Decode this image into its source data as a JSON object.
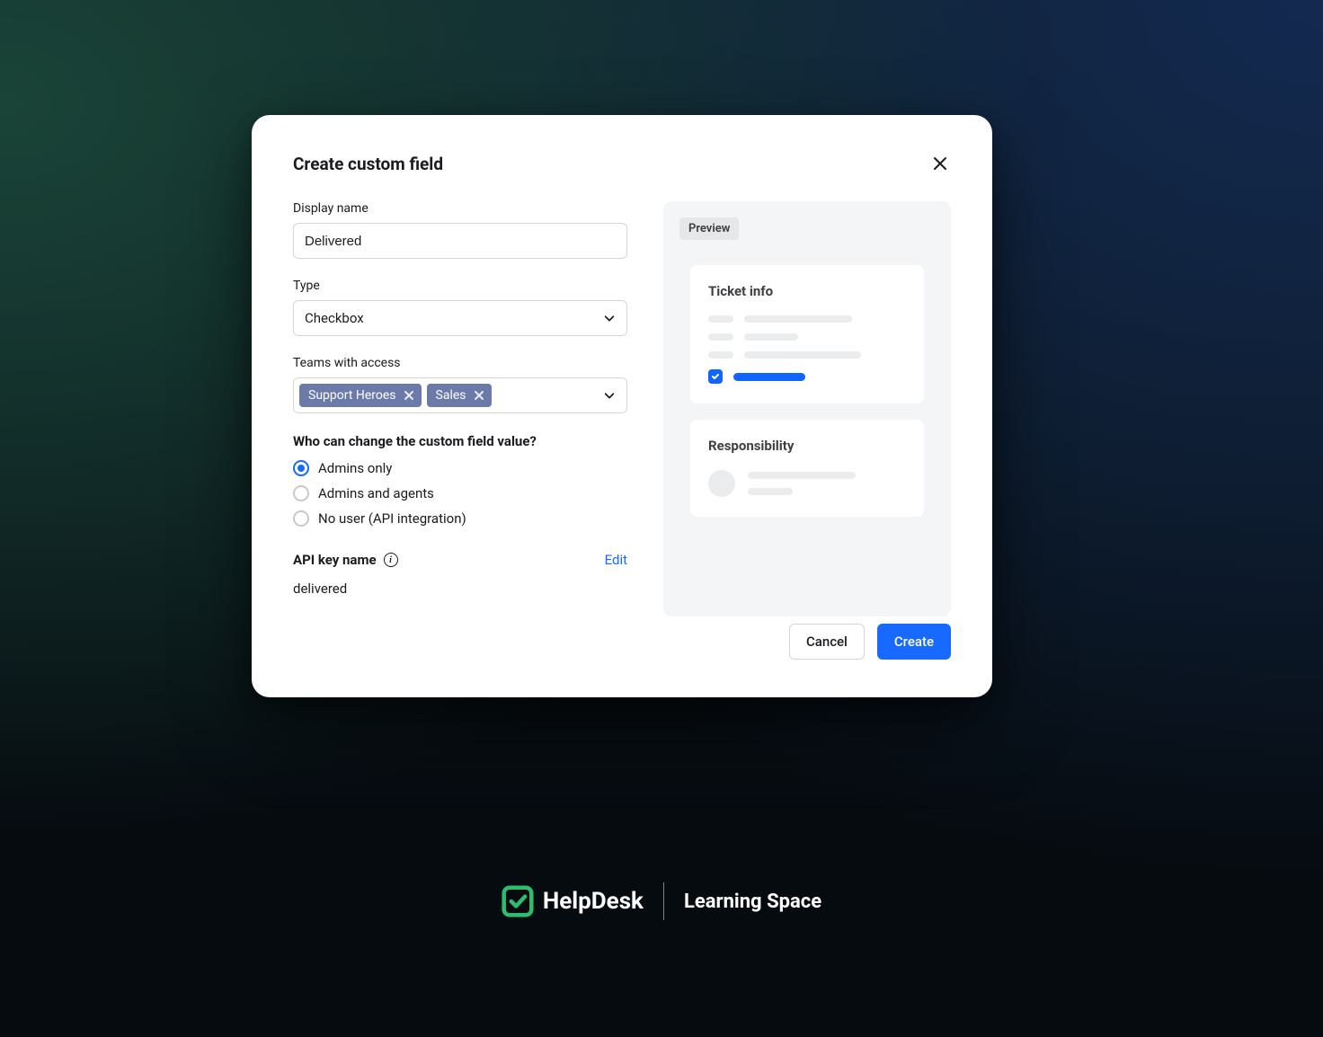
{
  "modal": {
    "title": "Create custom field",
    "display_name": {
      "label": "Display name",
      "value": "Delivered"
    },
    "type": {
      "label": "Type",
      "value": "Checkbox"
    },
    "teams": {
      "label": "Teams with access",
      "tags": [
        "Support Heroes",
        "Sales"
      ]
    },
    "permissions": {
      "heading": "Who can change the custom field value?",
      "options": [
        {
          "label": "Admins only",
          "selected": true
        },
        {
          "label": "Admins and agents",
          "selected": false
        },
        {
          "label": "No user (API integration)",
          "selected": false
        }
      ]
    },
    "api_key": {
      "label": "API key name",
      "edit_label": "Edit",
      "value": "delivered"
    },
    "preview": {
      "badge": "Preview",
      "ticket_info_title": "Ticket info",
      "responsibility_title": "Responsibility"
    },
    "footer": {
      "cancel": "Cancel",
      "create": "Create"
    }
  },
  "brand": {
    "name": "HelpDesk",
    "sub": "Learning Space"
  }
}
